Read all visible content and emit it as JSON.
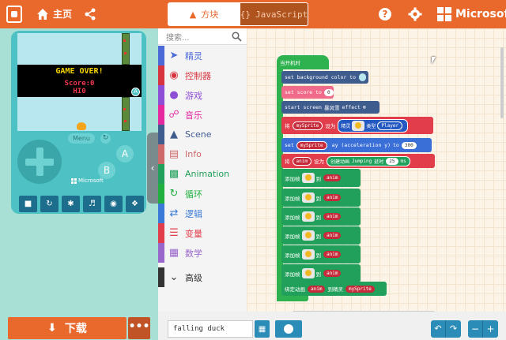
{
  "header": {
    "home_label": "主页",
    "tab_blocks": "方块",
    "tab_js": "JavaScript",
    "tab_js_icon": "{}",
    "brand": "Microsoft",
    "help_glyph": "?"
  },
  "simulator": {
    "game_over": "GAME OVER!",
    "score_line": "Score:0",
    "hi_line": "HI0",
    "menu_label": "Menu",
    "a_label": "A",
    "b_label": "B",
    "mini_a": "A",
    "device_brand": "Microsoft"
  },
  "download": {
    "label": "下载",
    "more": "•••"
  },
  "toolbox": {
    "search_placeholder": "搜索...",
    "categories": [
      {
        "label": "精灵",
        "color": "#4b6ad8",
        "icon": "paper-plane-icon"
      },
      {
        "label": "控制器",
        "color": "#d8343f",
        "icon": "gamepad-icon"
      },
      {
        "label": "游戏",
        "color": "#8f4ed6",
        "icon": "circle-icon"
      },
      {
        "label": "音乐",
        "color": "#e6299f",
        "icon": "headphones-icon"
      },
      {
        "label": "Scene",
        "color": "#3f5c8e",
        "icon": "tree-icon"
      },
      {
        "label": "Info",
        "color": "#cf6a6a",
        "icon": "id-card-icon"
      },
      {
        "label": "Animation",
        "color": "#20a05a",
        "icon": "film-icon"
      },
      {
        "label": "循环",
        "color": "#20b040",
        "icon": "refresh-icon"
      },
      {
        "label": "逻辑",
        "color": "#3a79d8",
        "icon": "shuffle-icon"
      },
      {
        "label": "变量",
        "color": "#e23d4b",
        "icon": "list-icon"
      },
      {
        "label": "数学",
        "color": "#9966cc",
        "icon": "calculator-icon"
      },
      {
        "label": "高级",
        "color": "#333333",
        "icon": "chevron-down-icon"
      }
    ]
  },
  "blocks": {
    "on_start": "当开机时",
    "set_bg": "set background color to",
    "set_score": "set score to",
    "score_value": "0",
    "start_screen": "start screen",
    "effect_name": "暴风雪",
    "effect": "effect",
    "set_var_kw": "将",
    "my_sprite": "mySprite",
    "set_to": "设为",
    "sprite_kw": "精灵",
    "type_kw": "类型",
    "player": "Player",
    "set_kw": "set",
    "accel": "ay (acceleration y)",
    "to_kw": "to",
    "accel_value": "300",
    "anim_var": "anim",
    "create_anim": "创建动画",
    "jumping": "Jumping",
    "delay_kw": "延时",
    "delay_value": "25",
    "ms": "ms",
    "add_frame": "添加帧",
    "to_anim": "到",
    "attach_anim": "绑定动画",
    "to_sprite": "到精灵"
  },
  "footer": {
    "project_name": "falling duck"
  }
}
